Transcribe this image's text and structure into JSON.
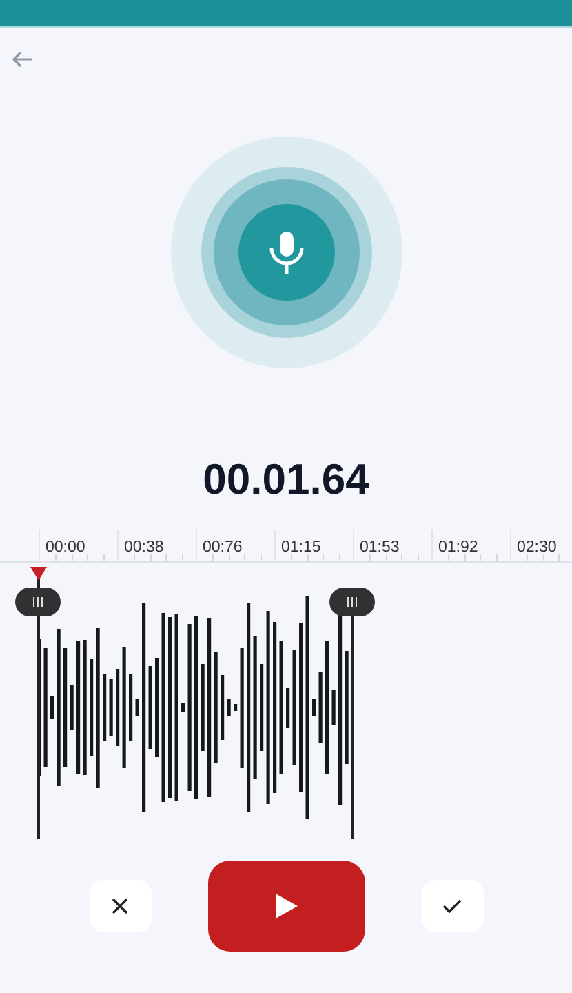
{
  "timer": "00.01.64",
  "ruler": [
    "00:00",
    "00:38",
    "00:76",
    "01:15",
    "01:53",
    "01:92",
    "02:30"
  ]
}
